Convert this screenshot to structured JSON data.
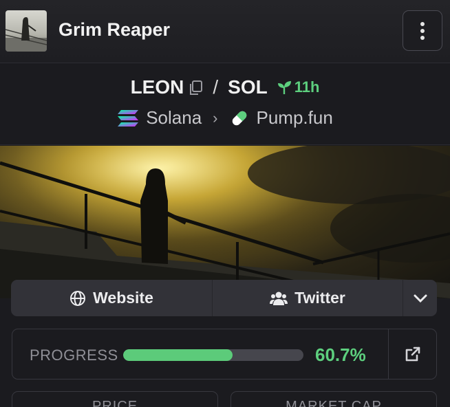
{
  "header": {
    "token_name": "Grim Reaper",
    "menu_icon": "kebab-menu-icon"
  },
  "pair": {
    "base": "LEON",
    "separator": "/",
    "quote": "SOL",
    "age": "11h",
    "chain": "Solana",
    "dex": "Pump.fun"
  },
  "links": {
    "website": "Website",
    "twitter": "Twitter"
  },
  "progress": {
    "label": "PROGRESS",
    "value": 60.7,
    "value_text": "60.7%"
  },
  "stats": {
    "price_label": "PRICE",
    "mcap_label": "MARKET CAP"
  },
  "colors": {
    "accent_green": "#5dcf7e",
    "background": "#1b1b1f",
    "panel": "#323238"
  }
}
